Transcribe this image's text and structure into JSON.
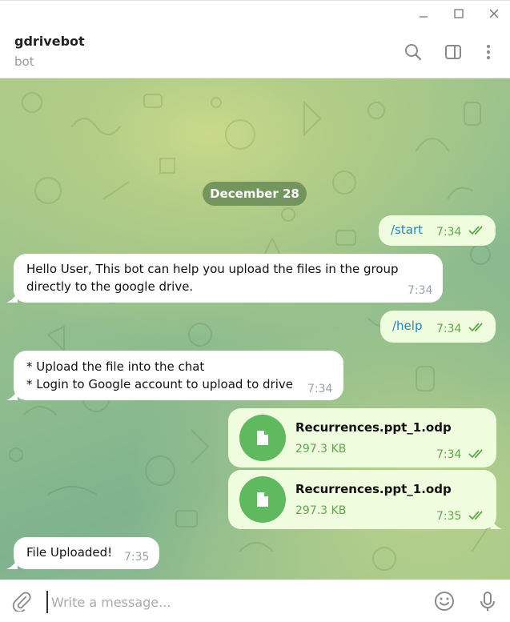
{
  "window": {
    "controls": [
      "minimize",
      "maximize",
      "close"
    ]
  },
  "header": {
    "title": "gdrivebot",
    "subtitle": "bot",
    "icons": [
      "search-icon",
      "sidebar-toggle-icon",
      "more-vert-icon"
    ]
  },
  "chat": {
    "date_label": "December 28",
    "messages": [
      {
        "dir": "out",
        "text": "/start",
        "time": "7:34",
        "read": true
      },
      {
        "dir": "in",
        "line1": "Hello User, This bot can help you upload the files in the group",
        "line2": "directly to the google drive.",
        "time": "7:34"
      },
      {
        "dir": "out",
        "text": "/help",
        "time": "7:34",
        "read": true
      },
      {
        "dir": "in",
        "line1": "* Upload the file into the chat",
        "line2": "* Login to Google account to upload to drive",
        "time": "7:34"
      },
      {
        "dir": "out",
        "type": "file",
        "name": "Recurrences.ppt_1.odp",
        "size": "297.3 KB",
        "time": "7:34",
        "read": true
      },
      {
        "dir": "out",
        "type": "file",
        "name": "Recurrences.ppt_1.odp",
        "size": "297.3 KB",
        "time": "7:35",
        "read": true
      },
      {
        "dir": "in",
        "text": "File Uploaded!",
        "time": "7:35"
      }
    ]
  },
  "composer": {
    "placeholder": "Write a message...",
    "icons": [
      "attach-icon",
      "emoji-icon",
      "microphone-icon"
    ]
  },
  "colors": {
    "outgoing_bubble": "#effdde",
    "incoming_bubble": "#ffffff",
    "accent_green": "#5fa84a",
    "command_link": "#1e86c8",
    "file_icon_bg": "#5fba5f"
  }
}
